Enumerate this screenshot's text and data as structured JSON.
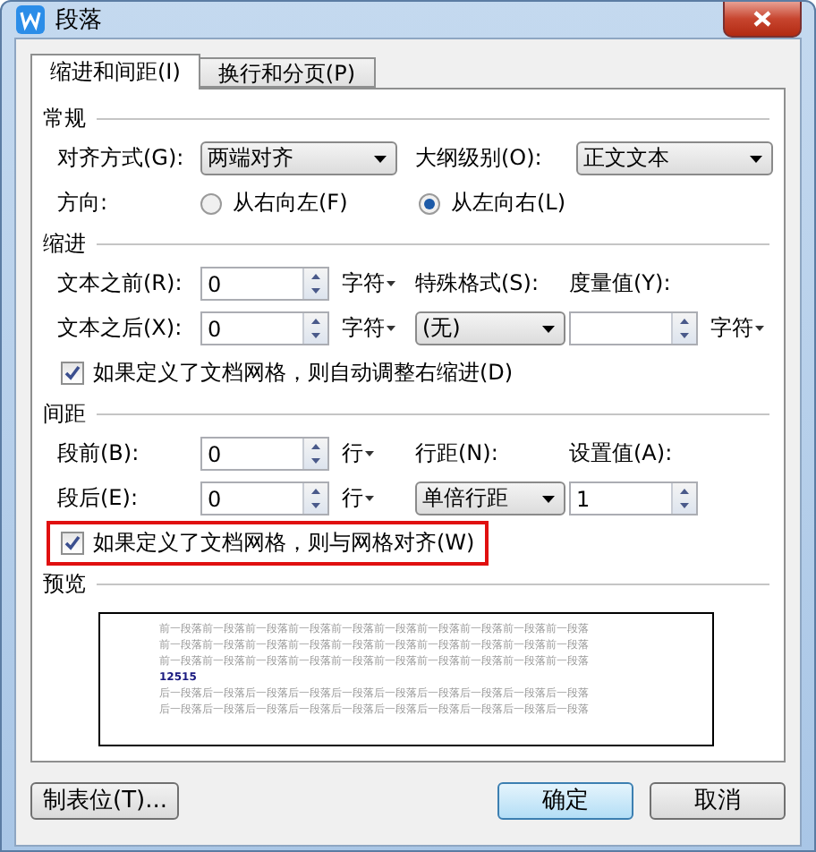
{
  "window": {
    "title": "段落"
  },
  "tabs": [
    {
      "label": "缩进和间距(I)",
      "selected": true
    },
    {
      "label": "换行和分页(P)",
      "selected": false
    }
  ],
  "general": {
    "heading": "常规",
    "alignment": {
      "label": "对齐方式(G):",
      "value": "两端对齐"
    },
    "outline_level": {
      "label": "大纲级别(O):",
      "value": "正文文本"
    },
    "direction": {
      "label": "方向:",
      "options": [
        {
          "label": "从右向左(F)",
          "selected": false
        },
        {
          "label": "从左向右(L)",
          "selected": true
        }
      ]
    }
  },
  "indent": {
    "heading": "缩进",
    "before": {
      "label": "文本之前(R):",
      "value": "0",
      "unit": "字符"
    },
    "after": {
      "label": "文本之后(X):",
      "value": "0",
      "unit": "字符"
    },
    "special": {
      "label": "特殊格式(S):",
      "value": "(无)"
    },
    "measure": {
      "label": "度量值(Y):",
      "unit": "字符"
    },
    "auto_adjust": {
      "label": "如果定义了文档网格，则自动调整右缩进(D)",
      "checked": true,
      "highlighted": false
    }
  },
  "spacing": {
    "heading": "间距",
    "before": {
      "label": "段前(B):",
      "value": "0",
      "unit": "行"
    },
    "after": {
      "label": "段后(E):",
      "value": "0",
      "unit": "行"
    },
    "line_spacing": {
      "label": "行距(N):",
      "value": "单倍行距"
    },
    "set_value": {
      "label": "设置值(A):",
      "value": "1"
    },
    "snap_to_grid": {
      "label": "如果定义了文档网格，则与网格对齐(W)",
      "checked": true,
      "highlighted": true
    }
  },
  "preview": {
    "heading": "预览",
    "before_lines": [
      "前一段落前一段落前一段落前一段落前一段落前一段落前一段落前一段落前一段落前一段落",
      "前一段落前一段落前一段落前一段落前一段落前一段落前一段落前一段落前一段落前一段落",
      "前一段落前一段落前一段落前一段落前一段落前一段落前一段落前一段落前一段落前一段落"
    ],
    "sample": "12515",
    "after_lines": [
      "后一段落后一段落后一段落后一段落后一段落后一段落后一段落后一段落后一段落后一段落",
      "后一段落后一段落后一段落后一段落后一段落后一段落后一段落后一段落后一段落后一段落"
    ]
  },
  "buttons": [
    {
      "label": "制表位(T)...",
      "kind": "secondary"
    },
    {
      "label": "确定",
      "kind": "default"
    },
    {
      "label": "取消",
      "kind": "secondary"
    }
  ]
}
